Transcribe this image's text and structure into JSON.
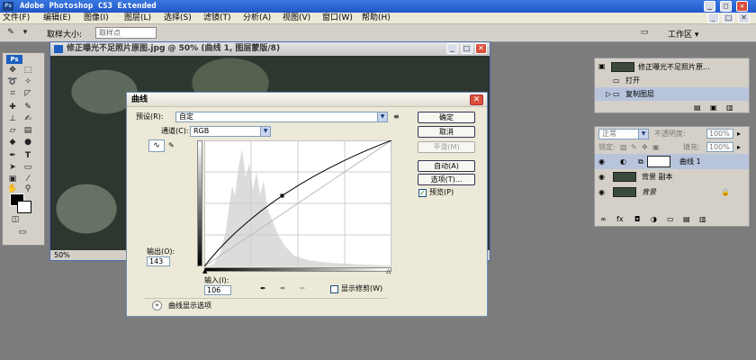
{
  "app": {
    "title": "Adobe Photoshop CS3 Extended",
    "ps_badge": "Ps"
  },
  "menu": [
    "文件(F)",
    "编辑(E)",
    "图像(I)",
    "图层(L)",
    "选择(S)",
    "滤镜(T)",
    "分析(A)",
    "视图(V)",
    "窗口(W)",
    "帮助(H)"
  ],
  "options_bar": {
    "sample_size_label": "取样大小:",
    "sample_size_value": "取样点",
    "workspace_label": "工作区 ▾"
  },
  "tools": {
    "ps_logo": "Ps"
  },
  "document": {
    "title": "修正曝光不足照片原图.jpg @ 50% (曲线 1, 图层蒙版/8)",
    "zoom": "50%"
  },
  "curves_dialog": {
    "title": "曲线",
    "preset_label": "预设(R):",
    "preset_value": "自定",
    "channel_label": "通道(C):",
    "channel_value": "RGB",
    "output_label": "输出(O):",
    "output_value": "143",
    "input_label": "输入(I):",
    "input_value": "106",
    "show_clipping_label": "显示修剪(W)",
    "show_clipping_checked": false,
    "display_options_label": "曲线显示选项",
    "buttons": {
      "ok": "确定",
      "cancel": "取消",
      "smooth": "平滑(M)",
      "auto": "自动(A)",
      "options": "选项(T)...",
      "preview": "预览(P)"
    },
    "preview_checked": true,
    "curve_point": {
      "input": 106,
      "output": 143
    }
  },
  "history_panel": {
    "snapshot_name": "修正曝光不足照片原...",
    "items": [
      "打开",
      "复制图层"
    ]
  },
  "layers_panel": {
    "blend_mode": "正常",
    "opacity_label": "不透明度:",
    "opacity_value": "100%",
    "lock_label": "锁定:",
    "fill_label": "填充:",
    "fill_value": "100%",
    "layers": [
      {
        "name": "曲线 1",
        "type": "adjustment"
      },
      {
        "name": "背景 副本",
        "type": "image"
      },
      {
        "name": "背景",
        "type": "background",
        "italic": true
      }
    ]
  }
}
